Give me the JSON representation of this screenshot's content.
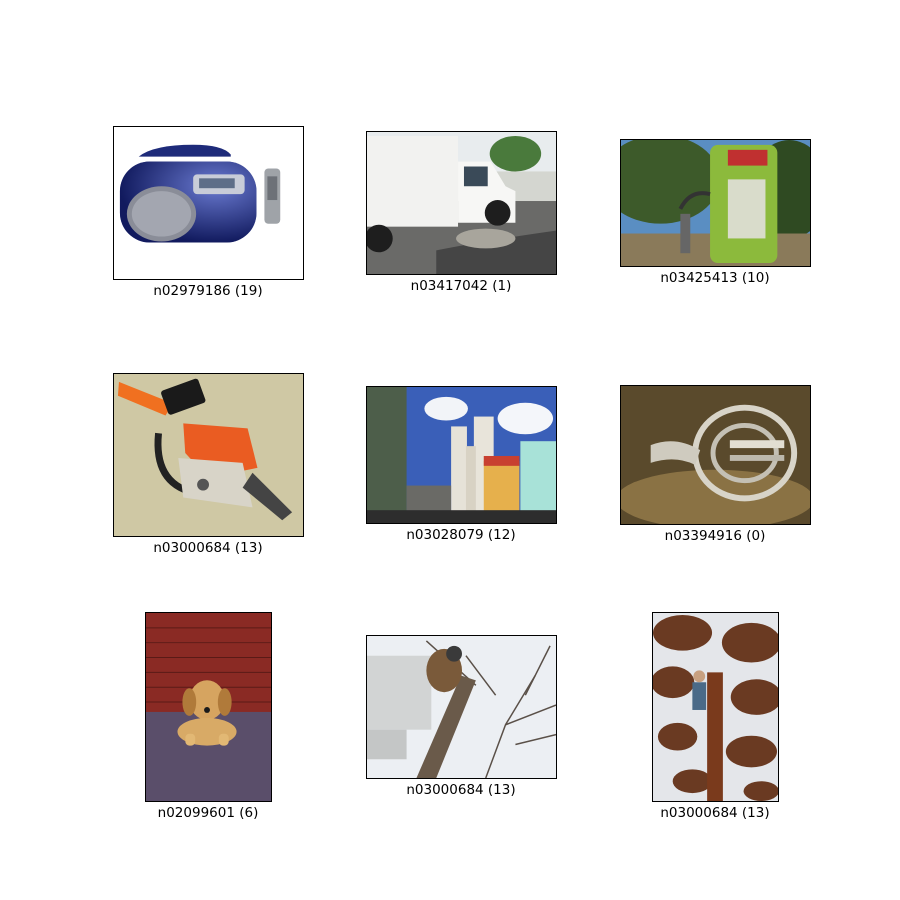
{
  "grid": {
    "images": [
      {
        "label": "n02979186 (19)",
        "subject": "portable CD boombox with remote control",
        "icon": "boombox-photo"
      },
      {
        "label": "n03417042 (1)",
        "subject": "white garbage truck on a street",
        "icon": "garbage-truck-photo"
      },
      {
        "label": "n03425413 (10)",
        "subject": "green vintage gas pump under trees",
        "icon": "gas-pump-photo"
      },
      {
        "label": "n03000684 (13)",
        "subject": "orange chainsaw on concrete",
        "icon": "chainsaw-photo"
      },
      {
        "label": "n03028079 (12)",
        "subject": "church towers and colorful colonial buildings",
        "icon": "church-photo"
      },
      {
        "label": "n03394916 (0)",
        "subject": "french horn on dark background",
        "icon": "french-horn-photo"
      },
      {
        "label": "n02099601 (6)",
        "subject": "golden retriever puppy lying by brick wall",
        "icon": "dog-photo"
      },
      {
        "label": "n03000684 (13)",
        "subject": "worker cutting tree branches from bucket lift",
        "icon": "tree-cutting-photo"
      },
      {
        "label": "n03000684 (13)",
        "subject": "arborist climbing a tall conifer",
        "icon": "arborist-photo"
      }
    ]
  }
}
